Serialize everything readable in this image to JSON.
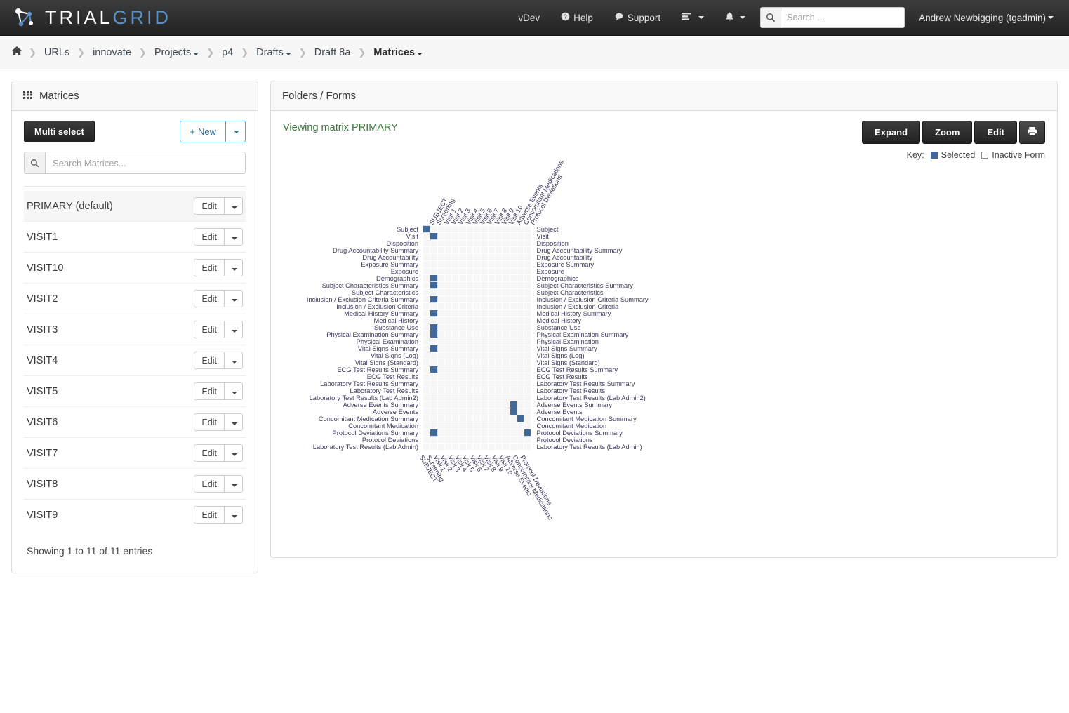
{
  "brand": {
    "part1": "TRIAL",
    "part2": "GRID"
  },
  "navbar": {
    "vdev": "vDev",
    "help": "Help",
    "support": "Support",
    "search_placeholder": "Search ...",
    "user": "Andrew Newbigging (tgadmin)"
  },
  "breadcrumb": {
    "home_icon": "home-icon",
    "items": [
      {
        "label": "URLs",
        "caret": false
      },
      {
        "label": "innovate",
        "caret": false
      },
      {
        "label": "Projects",
        "caret": true
      },
      {
        "label": "p4",
        "caret": false
      },
      {
        "label": "Drafts",
        "caret": true
      },
      {
        "label": "Draft 8a",
        "caret": false
      },
      {
        "label": "Matrices",
        "caret": true
      }
    ]
  },
  "sidebar": {
    "title": "Matrices",
    "multi_select": "Multi select",
    "new_label": "New",
    "search_placeholder": "Search Matrices...",
    "items": [
      {
        "name": "PRIMARY (default)",
        "edit": "Edit"
      },
      {
        "name": "VISIT1",
        "edit": "Edit"
      },
      {
        "name": "VISIT10",
        "edit": "Edit"
      },
      {
        "name": "VISIT2",
        "edit": "Edit"
      },
      {
        "name": "VISIT3",
        "edit": "Edit"
      },
      {
        "name": "VISIT4",
        "edit": "Edit"
      },
      {
        "name": "VISIT5",
        "edit": "Edit"
      },
      {
        "name": "VISIT6",
        "edit": "Edit"
      },
      {
        "name": "VISIT7",
        "edit": "Edit"
      },
      {
        "name": "VISIT8",
        "edit": "Edit"
      },
      {
        "name": "VISIT9",
        "edit": "Edit"
      }
    ],
    "showing": "Showing 1 to 11 of 11 entries"
  },
  "main": {
    "title": "Folders / Forms",
    "viewing": "Viewing matrix PRIMARY",
    "buttons": {
      "expand": "Expand",
      "zoom": "Zoom",
      "edit": "Edit",
      "print_icon": "printer-icon"
    },
    "key_label": "Key:",
    "key_selected": "Selected",
    "key_inactive": "Inactive Form"
  },
  "chart_data": {
    "type": "heatmap",
    "title": "Viewing matrix PRIMARY",
    "colors": {
      "selected": "#41689a",
      "empty": "#f6f6f6"
    },
    "columns": [
      "SUBJECT",
      "Screening",
      "Visit 1",
      "Visit 2",
      "Visit 3",
      "Visit 4",
      "Visit 5",
      "Visit 6",
      "Visit 7",
      "Visit 8",
      "Visit 9",
      "Visit 10",
      "Adverse Events",
      "Concomitant Medications",
      "Protocol Deviations"
    ],
    "rows": [
      "Subject",
      "Visit",
      "Disposition",
      "Drug Accountability Summary",
      "Drug Accountability",
      "Exposure Summary",
      "Exposure",
      "Demographics",
      "Subject Characteristics Summary",
      "Subject Characteristics",
      "Inclusion / Exclusion Criteria Summary",
      "Inclusion / Exclusion Criteria",
      "Medical History Summary",
      "Medical History",
      "Substance Use",
      "Physical Examination Summary",
      "Physical Examination",
      "Vital Signs Summary",
      "Vital Signs (Log)",
      "Vital Signs (Standard)",
      "ECG Test Results Summary",
      "ECG Test Results",
      "Laboratory Test Results Summary",
      "Laboratory Test Results",
      "Laboratory Test Results (Lab Admin2)",
      "Adverse Events Summary",
      "Adverse Events",
      "Concomitant Medication Summary",
      "Concomitant Medication",
      "Protocol Deviations Summary",
      "Protocol Deviations",
      "Laboratory Test Results (Lab Admin)"
    ],
    "selected_cells": [
      [
        0,
        0
      ],
      [
        1,
        1
      ],
      [
        7,
        1
      ],
      [
        8,
        1
      ],
      [
        10,
        1
      ],
      [
        12,
        1
      ],
      [
        14,
        1
      ],
      [
        15,
        1
      ],
      [
        17,
        1
      ],
      [
        20,
        1
      ],
      [
        25,
        12
      ],
      [
        26,
        12
      ],
      [
        27,
        13
      ],
      [
        29,
        1
      ],
      [
        29,
        14
      ]
    ]
  }
}
